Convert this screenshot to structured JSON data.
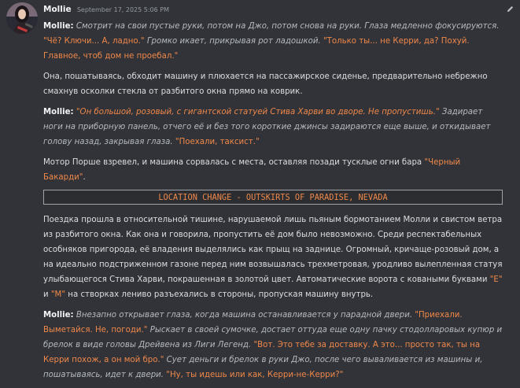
{
  "message": {
    "username": "Mollie",
    "timestamp": "September 17, 2025 5:06 PM",
    "p1": {
      "speaker": "Mollie:",
      "a1": "Смотрит на свои пустые руки, потом на Джо, потом снова на руки. Глаза медленно фокусируются.",
      "q1": "\"Чё? Ключи... А, ладно.\"",
      "a2": "Громко икает, прикрывая рот ладошкой.",
      "q2": "\"Только ты... не Керри, да? Похуй. Главное, чтоб дом не проебал.\""
    },
    "p2": "Она, пошатываясь, обходит машину и плюхается на пассажирское сиденье, предварительно небрежно смахнув осколки стекла от разбитого окна прямо на коврик.",
    "p3": {
      "speaker": "Mollie:",
      "q1": "\"Он большой, розовый, с гигантской статуей Стива Харви во дворе. Не пропустишь.\"",
      "a1": "Задирает ноги на приборную панель, отчего её и без того короткие джинсы задираются еще выше, и откидывает голову назад, закрывая глаза.",
      "q2": "\"Поехали, таксист.\""
    },
    "p4": {
      "text": "Мотор Порше взревел, и машина сорвалась с места, оставляя позади тусклые огни бара",
      "highlight": "\"Черный Бакарди\"",
      "end": "."
    },
    "location": "LOCATION CHANGE - OUTSKIRTS OF PARADISE, NEVADA",
    "p5": {
      "text": "Поездка прошла в относительной тишине, нарушаемой лишь пьяным бормотанием Молли и свистом ветра из разбитого окна. Как она и говорила, пропустить её дом было невозможно. Среди респектабельных особняков пригорода, её владения выделялись как прыщ на заднице. Огромный, кричаще-розовый дом, а на идеально подстриженном газоне перед ним возвышалась трехметровая, уродливо вылепленная статуя улыбающегося Стива Харви, покрашенная в золотой цвет. Автоматические ворота с коваными буквами",
      "e": "\"E\"",
      "and": "и",
      "m": "\"M\"",
      "end": "на створках лениво разъехались в стороны, пропуская машину внутрь."
    },
    "p6": {
      "speaker": "Mollie:",
      "a1": "Внезапно открывает глаза, когда машина останавливается у парадной двери.",
      "q1": "\"Приехали. Выметайся. Не, погоди.\"",
      "a2": "Рыскает в своей сумочке, достает оттуда еще одну пачку стодолларовых купюр и брелок в виде головы Дрейвена из Лиги Легенд.",
      "q2": "\"Вот. Это тебе за доставку. А это... просто так, ты на Керри похож, а он мой бро.\"",
      "a3": "Сует деньги и брелок в руки Джо, после чего вываливается из машины и, пошатываясь, идет к двери.",
      "q3": "\"Ну, ты идешь или как, Керри-не-Керри?\""
    }
  },
  "icons": {
    "edit": "pencil-icon",
    "avatar": "avatar"
  },
  "colors": {
    "background": "#313338",
    "quote": "#f0884a",
    "action": "#b5bac1",
    "text": "#dbdee1"
  }
}
